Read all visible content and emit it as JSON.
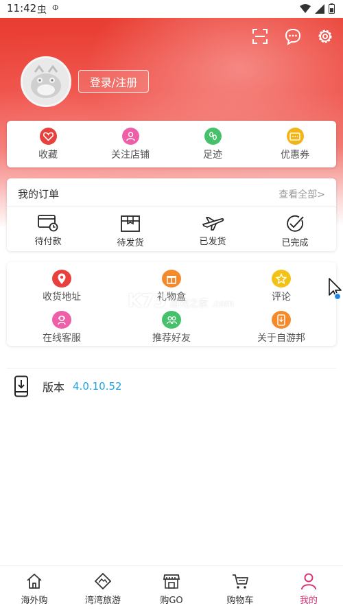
{
  "status_bar": {
    "time": "11:42",
    "glyph_a": "虫",
    "glyph_b": "Ф"
  },
  "header": {
    "login_label": "登录/注册"
  },
  "quick_links": [
    {
      "label": "收藏",
      "icon": "heart-icon",
      "color": "#e8403c"
    },
    {
      "label": "关注店铺",
      "icon": "user-follow-icon",
      "color": "#ef5fa7"
    },
    {
      "label": "足迹",
      "icon": "footprint-icon",
      "color": "#46c06b"
    },
    {
      "label": "优惠券",
      "icon": "coupon-icon",
      "color": "#f2b416"
    }
  ],
  "orders": {
    "title": "我的订单",
    "view_all": "查看全部>",
    "items": [
      {
        "label": "待付款",
        "icon": "pending-payment-icon"
      },
      {
        "label": "待发货",
        "icon": "pending-shipment-icon"
      },
      {
        "label": "已发货",
        "icon": "shipped-plane-icon"
      },
      {
        "label": "已完成",
        "icon": "completed-check-icon"
      }
    ]
  },
  "services": [
    {
      "label": "收货地址",
      "icon": "location-icon",
      "color": "#e8403c"
    },
    {
      "label": "礼物盒",
      "icon": "gift-icon",
      "color": "#f58a2a"
    },
    {
      "label": "评论",
      "icon": "star-icon",
      "color": "#f2c316"
    },
    {
      "label": "在线客服",
      "icon": "customer-service-icon",
      "color": "#ef5fa7"
    },
    {
      "label": "推荐好友",
      "icon": "friends-icon",
      "color": "#46c06b"
    },
    {
      "label": "关于自游邦",
      "icon": "about-phone-icon",
      "color": "#f58a2a"
    }
  ],
  "version": {
    "label": "版本",
    "value": "4.0.10.52"
  },
  "watermark": {
    "brand": "K73",
    "tagline": "游戏之家",
    "domain": ".com"
  },
  "tabs": [
    {
      "label": "海外购",
      "icon": "home-icon"
    },
    {
      "label": "湾湾旅游",
      "icon": "travel-icon"
    },
    {
      "label": "购GO",
      "icon": "shop-icon"
    },
    {
      "label": "购物车",
      "icon": "cart-icon"
    },
    {
      "label": "我的",
      "icon": "profile-icon",
      "active": true
    }
  ],
  "colors": {
    "accent": "#d8367a",
    "hero": "#e83a2e",
    "version": "#1fa3e6"
  }
}
